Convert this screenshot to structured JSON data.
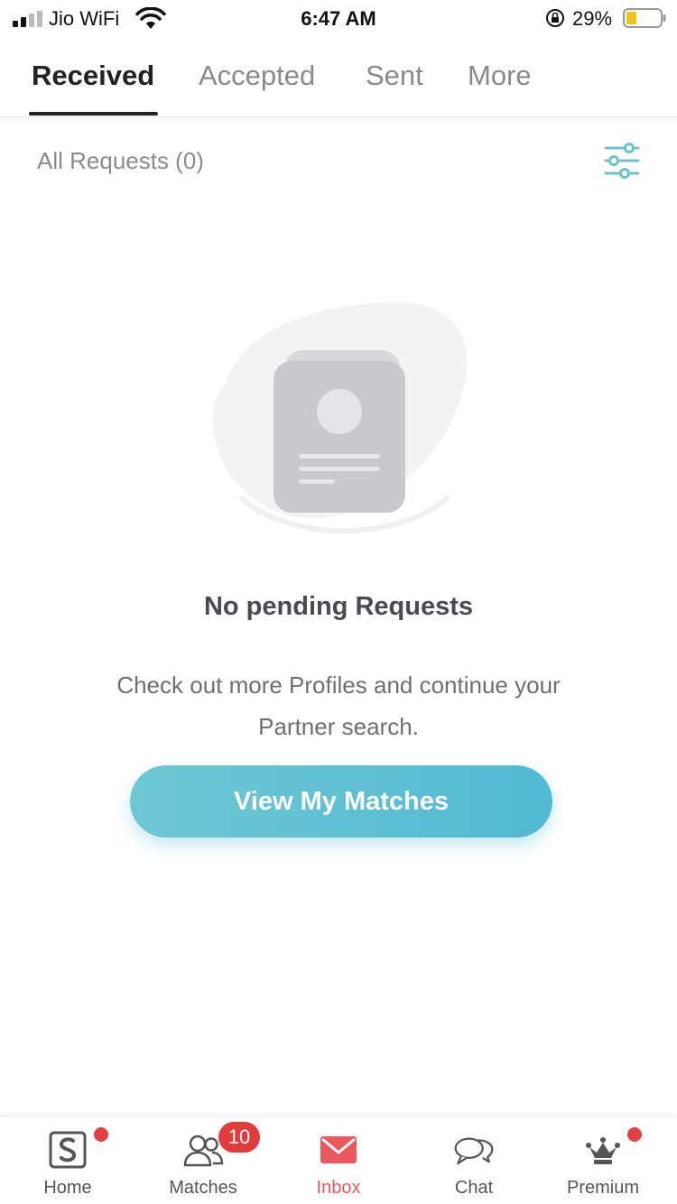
{
  "status_bar": {
    "carrier": "Jio WiFi",
    "time": "6:47 AM",
    "battery": "29%",
    "icons": [
      "signal-icon",
      "wifi-icon",
      "orientation-lock-icon",
      "battery-icon"
    ]
  },
  "tabs": [
    {
      "label": "Received",
      "active": true
    },
    {
      "label": "Accepted",
      "active": false
    },
    {
      "label": "Sent",
      "active": false
    },
    {
      "label": "More",
      "active": false
    }
  ],
  "subheader": {
    "title": "All Requests (0)",
    "filter_icon": "sliders-icon"
  },
  "empty_state": {
    "title": "No pending Requests",
    "description": "Check out more Profiles and continue your Partner search.",
    "cta": "View My Matches"
  },
  "bottom_nav": {
    "items": [
      {
        "label": "Home",
        "icon": "home-logo-icon",
        "dot": true
      },
      {
        "label": "Matches",
        "icon": "people-icon",
        "badge": "10"
      },
      {
        "label": "Inbox",
        "icon": "mail-icon",
        "active": true
      },
      {
        "label": "Chat",
        "icon": "chat-bubbles-icon"
      },
      {
        "label": "Premium",
        "icon": "crown-icon",
        "dot": true
      }
    ]
  },
  "colors": {
    "accent": "#5bbfd3",
    "active_nav": "#e9585d",
    "badge": "#e23b3b",
    "filter_icon": "#6cc4c6"
  }
}
